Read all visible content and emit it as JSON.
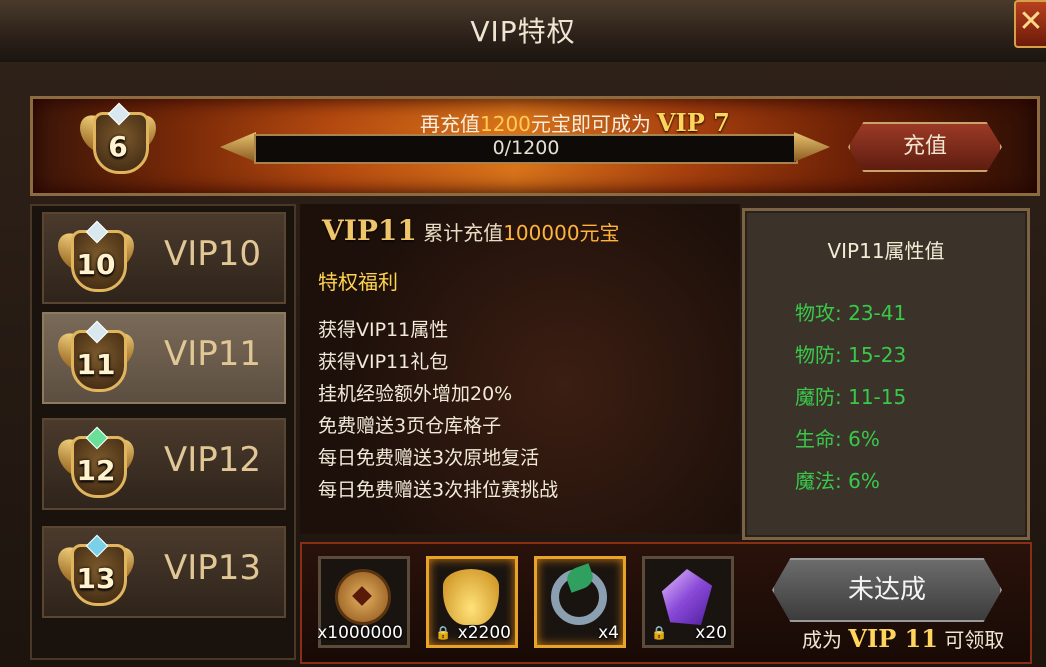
{
  "window": {
    "title": "VIP特权",
    "close_icon": "close-icon"
  },
  "banner": {
    "current_level": "6",
    "text_prefix": "再充值",
    "amount": "1200",
    "text_middle": "元宝即可成为",
    "next_vip": "VIP 7",
    "progress_text": "0/1200",
    "progress_fraction": 0.0,
    "recharge_label": "充值"
  },
  "sidebar": {
    "items": [
      {
        "label": "VIP10",
        "level": "10"
      },
      {
        "label": "VIP11",
        "level": "11"
      },
      {
        "label": "VIP12",
        "level": "12"
      },
      {
        "label": "VIP13",
        "level": "13"
      }
    ],
    "selected": "VIP11"
  },
  "detail": {
    "vip_label": "VIP11",
    "cumulative_text": "累计充值",
    "cumulative_amount": "100000元宝",
    "perks_title": "特权福利",
    "perks": [
      "获得VIP11属性",
      "获得VIP11礼包",
      "挂机经验额外增加20%",
      "免费赠送3页仓库格子",
      "每日免费赠送3次原地复活",
      "每日免费赠送3次排位赛挑战"
    ]
  },
  "attributes": {
    "title": "VIP11属性值",
    "rows": [
      {
        "name": "物攻:",
        "value": "23-41"
      },
      {
        "name": "物防:",
        "value": "15-23"
      },
      {
        "name": "魔防:",
        "value": "11-15"
      },
      {
        "name": "生命:",
        "value": "6%"
      },
      {
        "name": "魔法:",
        "value": "6%"
      }
    ]
  },
  "rewards": {
    "items": [
      {
        "icon": "coin-icon",
        "count": "x1000000",
        "locked": false
      },
      {
        "icon": "gold-ingot-icon",
        "count": "x2200",
        "locked": true
      },
      {
        "icon": "ring-icon",
        "count": "x4",
        "locked": false
      },
      {
        "icon": "crystal-icon",
        "count": "x20",
        "locked": true
      }
    ],
    "button_label": "未达成",
    "hint_prefix": "成为",
    "hint_vip": "VIP 11",
    "hint_suffix": "可领取"
  },
  "colors": {
    "accent_gold": "#ffd65c",
    "attr_green": "#39c94a",
    "perk_title": "#ffd34e"
  }
}
